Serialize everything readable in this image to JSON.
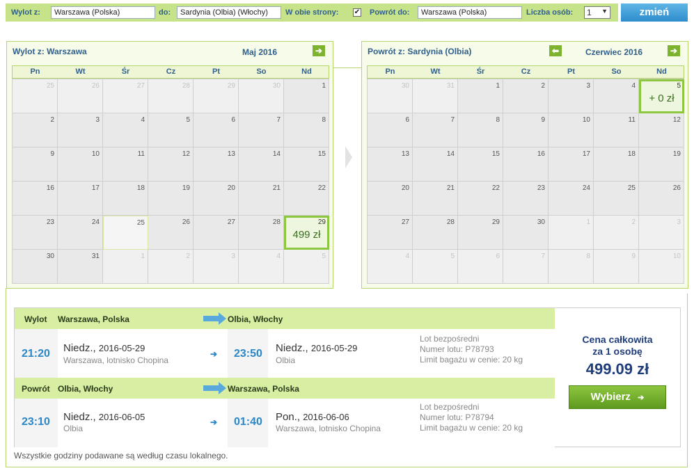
{
  "search": {
    "from_label": "Wylot z:",
    "from_value": "Warszawa (Polska)",
    "to_label": "do:",
    "to_value": "Sardynia (Olbia) (Włochy)",
    "roundtrip_label": "W obie strony:",
    "roundtrip_checked": "✔",
    "return_label": "Powrót do:",
    "return_value": "Warszawa (Polska)",
    "persons_label": "Liczba osób:",
    "persons_value": "1",
    "change_button": "zmień"
  },
  "calendars": {
    "dow": [
      "Pn",
      "Wt",
      "Śr",
      "Cz",
      "Pt",
      "So",
      "Nd"
    ],
    "outbound": {
      "title_prefix": "Wylot z:",
      "title_place": "Warszawa",
      "month": "Maj 2016",
      "selected_price": "499 zł",
      "days": [
        "25",
        "26",
        "27",
        "28",
        "29",
        "30",
        "1",
        "2",
        "3",
        "4",
        "5",
        "6",
        "7",
        "8",
        "9",
        "10",
        "11",
        "12",
        "13",
        "14",
        "15",
        "16",
        "17",
        "18",
        "19",
        "20",
        "21",
        "22",
        "23",
        "24",
        "25",
        "26",
        "27",
        "28",
        "29",
        "30",
        "31",
        "1",
        "2",
        "3",
        "4",
        "5"
      ]
    },
    "return": {
      "title_prefix": "Powrót z:",
      "title_place": "Sardynia (Olbia)",
      "month": "Czerwiec 2016",
      "selected_price": "+ 0 zł",
      "days": [
        "30",
        "31",
        "1",
        "2",
        "3",
        "4",
        "5",
        "6",
        "7",
        "8",
        "9",
        "10",
        "11",
        "12",
        "13",
        "14",
        "15",
        "16",
        "17",
        "18",
        "19",
        "20",
        "21",
        "22",
        "23",
        "24",
        "25",
        "26",
        "27",
        "28",
        "29",
        "30",
        "1",
        "2",
        "3",
        "4",
        "5",
        "6",
        "7",
        "8",
        "9",
        "10"
      ]
    }
  },
  "flights": {
    "outbound": {
      "label": "Wylot",
      "from": "Warszawa, Polska",
      "to": "Olbia, Włochy",
      "dep_time": "21:20",
      "dep_day": "Niedz.,",
      "dep_date": "2016-05-29",
      "dep_place": "Warszawa, lotnisko Chopina",
      "arr_time": "23:50",
      "arr_day": "Niedz.,",
      "arr_date": "2016-05-29",
      "arr_place": "Olbia",
      "info1": "Lot bezpośredni",
      "info2": "Numer lotu: P78793",
      "info3": "Limit bagażu w cenie: 20 kg"
    },
    "return": {
      "label": "Powrót",
      "from": "Olbia, Włochy",
      "to": "Warszawa, Polska",
      "dep_time": "23:10",
      "dep_day": "Niedz.,",
      "dep_date": "2016-06-05",
      "dep_place": "Olbia",
      "arr_time": "01:40",
      "arr_day": "Pon.,",
      "arr_date": "2016-06-06",
      "arr_place": "Warszawa, lotnisko Chopina",
      "info1": "Lot bezpośredni",
      "info2": "Numer lotu: P78794",
      "info3": "Limit bagażu w cenie: 20 kg"
    }
  },
  "price": {
    "label_line1": "Cena całkowita",
    "label_line2": "za 1 osobę",
    "value": "499.09 zł",
    "select_button": "Wybierz",
    "select_arrow": "➔"
  },
  "footnote": "Wszystkie godziny podawane są według czasu lokalnego.",
  "icons": {
    "next": "➔",
    "prev": "⬅",
    "small_arrow": "➔",
    "dropdown": "▼"
  },
  "colors": {
    "accent_green": "#8dc63f",
    "accent_blue": "#2a87c8",
    "header_green": "#c7e38a"
  }
}
